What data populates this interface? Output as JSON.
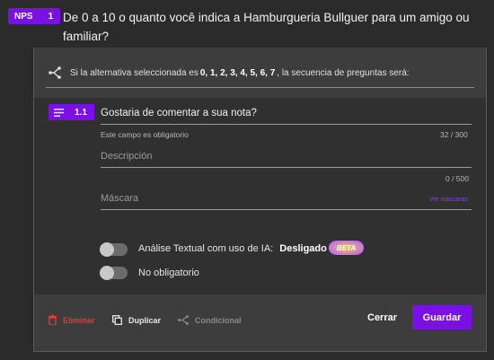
{
  "question": {
    "type_badge": "NPS",
    "number": "1",
    "title": "De 0 a 10 o quanto você indica a Hamburgueria Bullguer para um amigo ou familiar?"
  },
  "branch_rule": {
    "prefix": "Si la alternativa seleccionada es",
    "values": "0, 1, 2, 3, 4, 5, 6, 7",
    "suffix": ", la secuencia de preguntas será:"
  },
  "sub_question": {
    "number": "1.1",
    "title": "Gostaria de comentar a sua nota?",
    "required_hint": "Este campo es obligatorio",
    "title_count": "32 / 300",
    "description_placeholder": "Descripción",
    "description_count": "0 / 500",
    "mask_placeholder": "Máscara",
    "mask_link": "Ver máscaras"
  },
  "toggles": {
    "ai_label": "Análise Textual com uso de IA:",
    "ai_state": "Desligado",
    "beta": "BETA",
    "optional_label": "No obligatorio"
  },
  "footer": {
    "delete": "Eliminar",
    "duplicate": "Duplicar",
    "conditional": "Condicional",
    "cancel": "Cerrar",
    "save": "Guardar"
  },
  "colors": {
    "accent": "#7b10e6",
    "danger": "#e23a3a",
    "link": "#8a3cff"
  }
}
